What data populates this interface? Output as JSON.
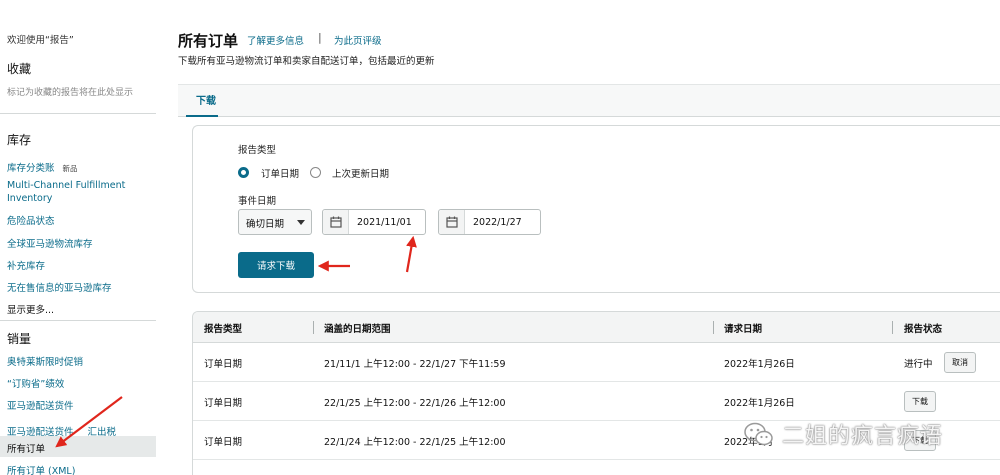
{
  "sidebar": {
    "welcome": "欢迎使用“报告”",
    "favorites_heading": "收藏",
    "favorites_hint": "标记为收藏的报告将在此处显示",
    "inventory_heading": "库存",
    "inventory_items": [
      {
        "label": "库存分类账",
        "badge": "新品"
      },
      {
        "label": "Multi-Channel Fulfillment Inventory"
      },
      {
        "label": "危险品状态"
      },
      {
        "label": "全球亚马逊物流库存"
      },
      {
        "label": "补充库存"
      },
      {
        "label": "无在售信息的亚马逊库存"
      }
    ],
    "show_more": "显示更多...",
    "sales_heading": "销量",
    "sales_items": [
      {
        "label": "奥特莱斯限时促销"
      },
      {
        "label": "“订购省”绩效"
      },
      {
        "label": "亚马逊配送货件"
      },
      {
        "label": "亚马逊配送货件",
        "extra": "汇出税"
      },
      {
        "label": "所有订单",
        "active": true
      },
      {
        "label": "所有订单 (XML)"
      }
    ]
  },
  "header": {
    "title": "所有订单",
    "learn_more": "了解更多信息",
    "separator": "|",
    "rate_page": "为此页评级",
    "subtitle": "下载所有亚马逊物流订单和卖家自配送订单，包括最近的更新"
  },
  "tabs": [
    {
      "label": "下载",
      "active": true
    }
  ],
  "form": {
    "report_type_label": "报告类型",
    "report_type_options": [
      {
        "label": "订单日期",
        "selected": true
      },
      {
        "label": "上次更新日期",
        "selected": false
      }
    ],
    "event_date_label": "事件日期",
    "date_mode": "确切日期",
    "start_date": "2021/11/01",
    "end_date": "2022/1/27",
    "request_button": "请求下载"
  },
  "table": {
    "headers": [
      "报告类型",
      "涵盖的日期范围",
      "请求日期",
      "报告状态"
    ],
    "rows": [
      {
        "type": "订单日期",
        "range": "21/11/1 上午12:00 - 22/1/27 下午11:59",
        "requested": "2022年1月26日",
        "status": "进行中",
        "action": "取消"
      },
      {
        "type": "订单日期",
        "range": "22/1/25 上午12:00 - 22/1/26 上午12:00",
        "requested": "2022年1月26日",
        "status": "",
        "action": "下载"
      },
      {
        "type": "订单日期",
        "range": "22/1/24 上午12:00 - 22/1/25 上午12:00",
        "requested": "2022年1月",
        "status": "",
        "action": "下载"
      }
    ]
  },
  "watermark": {
    "text": "二姐的疯言疯语",
    "icon": "wechat-icon"
  },
  "colors": {
    "accent": "#0a6b8a",
    "arrow": "#e0261c",
    "active_bg": "#e6e9e9"
  }
}
